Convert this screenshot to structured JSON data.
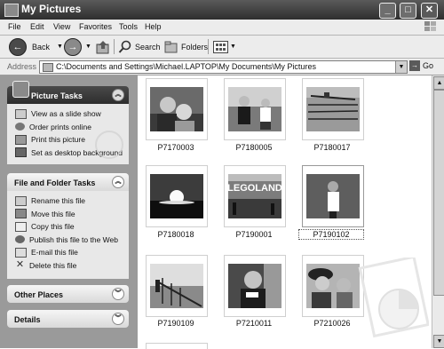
{
  "window": {
    "title": "My Pictures"
  },
  "title_buttons": [
    "_",
    "□",
    "✕"
  ],
  "menu": [
    "File",
    "Edit",
    "View",
    "Favorites",
    "Tools",
    "Help"
  ],
  "toolbar": {
    "back_label": "Back",
    "search_label": "Search",
    "folders_label": "Folders"
  },
  "address": {
    "label": "Address",
    "path": "C:\\Documents and Settings\\Michael.LAPTOP\\My Documents\\My Pictures",
    "go_label": "Go"
  },
  "picture_tasks": {
    "title": "Picture Tasks",
    "items": [
      "View as a slide show",
      "Order prints online",
      "Print this picture",
      "Set as desktop background"
    ]
  },
  "file_folder_tasks": {
    "title": "File and Folder Tasks",
    "items": [
      "Rename this file",
      "Move this file",
      "Copy this file",
      "Publish this file to the Web",
      "E-mail this file",
      "Delete this file"
    ]
  },
  "other_places": {
    "title": "Other Places"
  },
  "details": {
    "title": "Details"
  },
  "thumbnails": [
    {
      "name": "P7170003"
    },
    {
      "name": "P7180005"
    },
    {
      "name": "P7180017"
    },
    {
      "name": "P7180018"
    },
    {
      "name": "P7190001"
    },
    {
      "name": "P7190102"
    },
    {
      "name": "P7190109"
    },
    {
      "name": "P7210011"
    },
    {
      "name": "P7210026"
    }
  ],
  "selected_thumbnail": "P7190102",
  "thumbnail_text": {
    "legoland_sign": "LEGOLAND"
  },
  "colors": {
    "titlebar": "#3a3a3a",
    "task_pane": "#9a9a9a",
    "panel_body": "#e8e8e8"
  }
}
